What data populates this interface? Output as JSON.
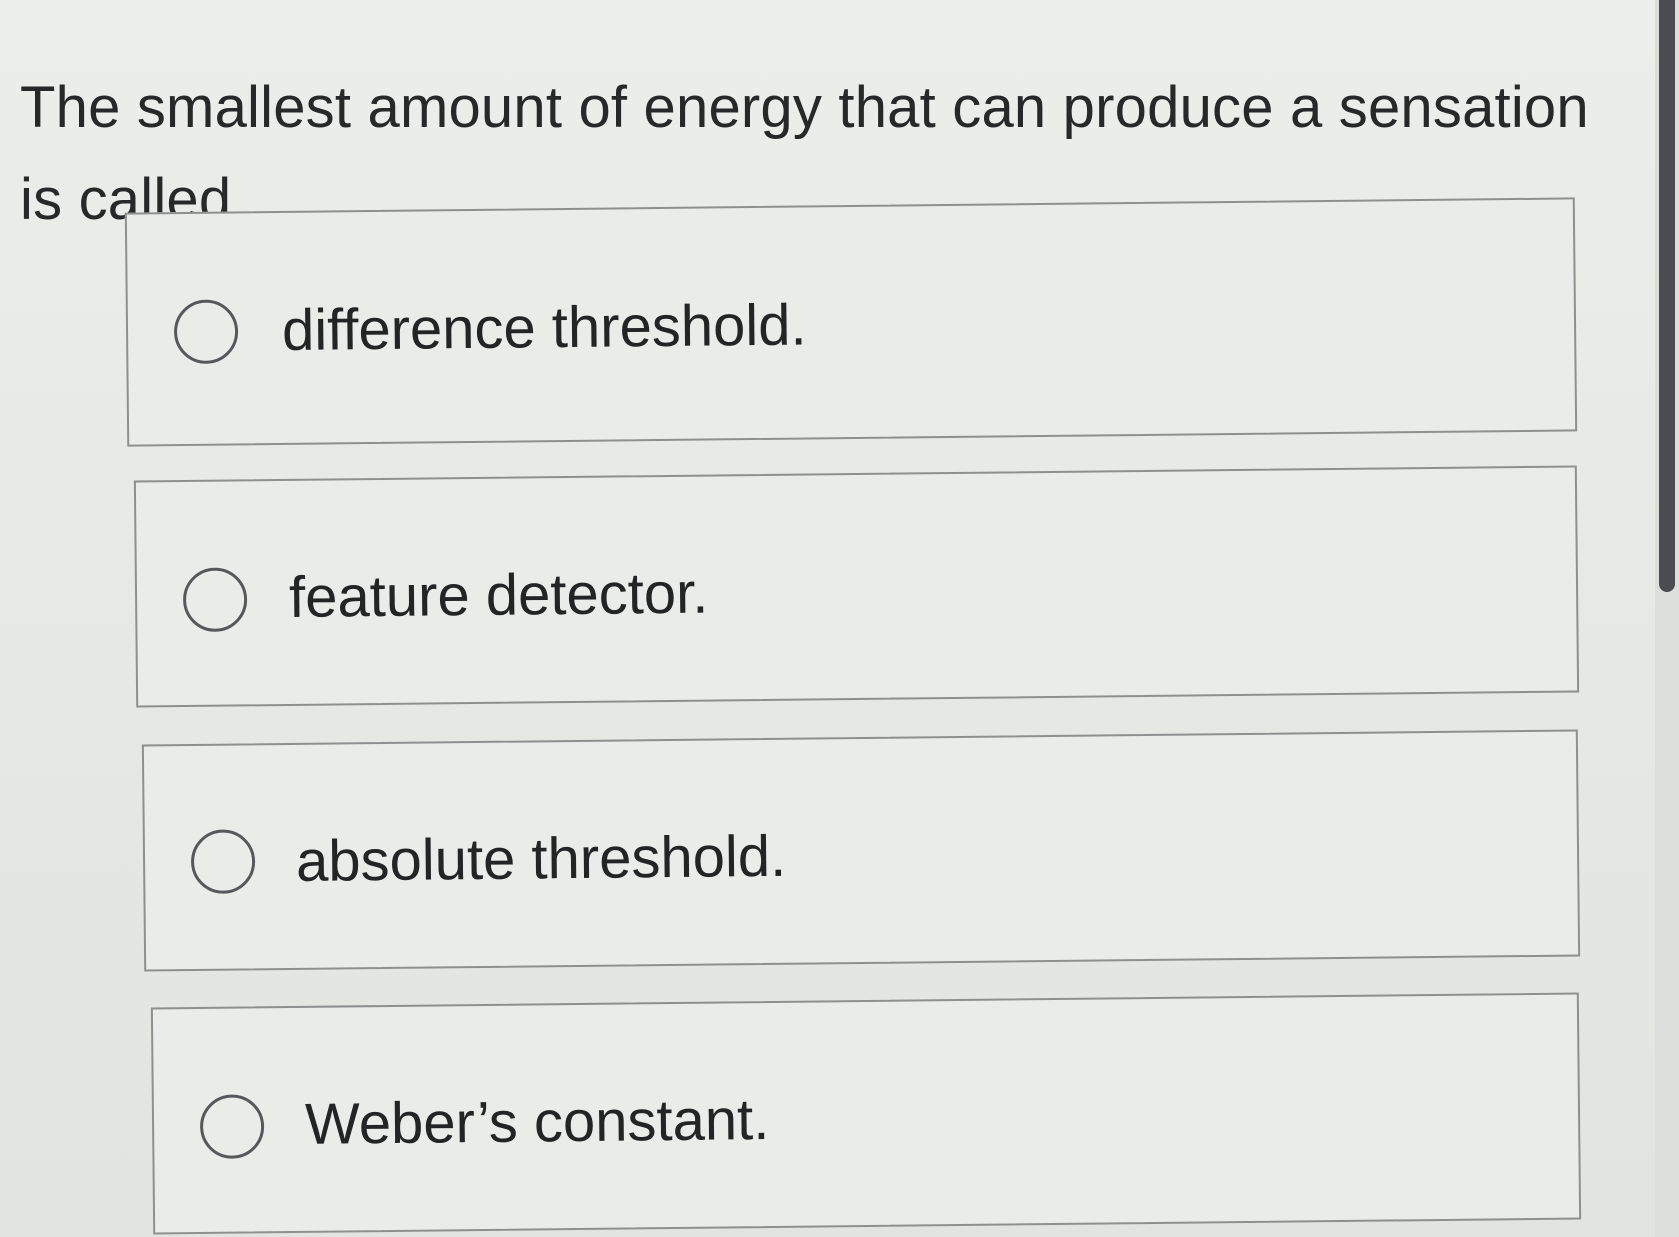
{
  "question": {
    "text": "The smallest amount of energy that can produce a sensation is called"
  },
  "options": [
    {
      "label": "difference threshold.",
      "selected": false
    },
    {
      "label": "feature detector.",
      "selected": false
    },
    {
      "label": "absolute threshold.",
      "selected": false
    },
    {
      "label": "Weber’s constant.",
      "selected": false
    }
  ],
  "colors": {
    "background": "#e7e9e6",
    "border": "#8d908f",
    "text": "#262829",
    "scrollbar_thumb": "#4a4d50"
  }
}
